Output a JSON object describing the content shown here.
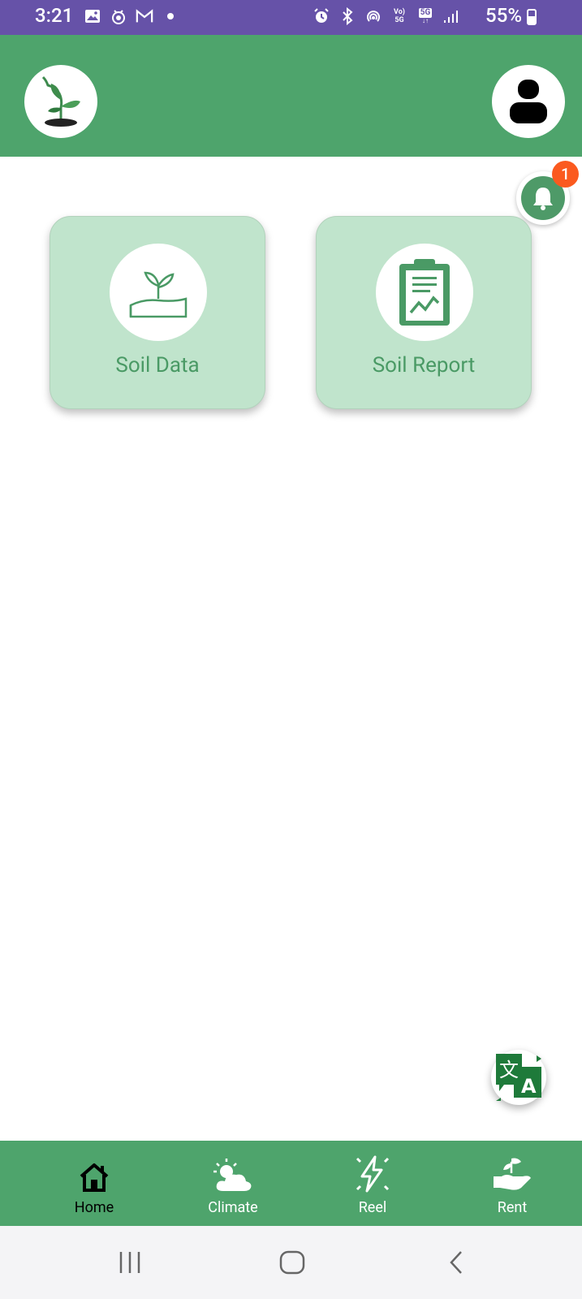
{
  "status_bar": {
    "time": "3:21",
    "battery": "55%",
    "network": "5G",
    "volte_top": "Vo)",
    "volte_bottom": "5G",
    "icons": [
      "gallery-icon",
      "notification-app-icon",
      "gmail-icon",
      "dot-icon",
      "alarm-icon",
      "bluetooth-icon",
      "hotspot-icon",
      "volte-icon",
      "network-5g-icon",
      "signal-icon",
      "battery-icon"
    ]
  },
  "header": {
    "logo_icon": "plant-logo-icon",
    "profile_icon": "user-avatar-icon",
    "background_color": "#4ea46c"
  },
  "notification": {
    "icon": "bell-icon",
    "badge_count": "1"
  },
  "cards": [
    {
      "label": "Soil Data",
      "icon": "soil-sprout-icon"
    },
    {
      "label": "Soil Report",
      "icon": "clipboard-report-icon"
    }
  ],
  "translate": {
    "icon": "translate-icon"
  },
  "bottom_nav": {
    "items": [
      {
        "label": "Home",
        "icon": "home-icon",
        "active": true
      },
      {
        "label": "Climate",
        "icon": "cloud-sun-icon",
        "active": false
      },
      {
        "label": "Reel",
        "icon": "lightning-icon",
        "active": false
      },
      {
        "label": "Rent",
        "icon": "hand-plant-icon",
        "active": false
      }
    ]
  },
  "system_nav": {
    "buttons": [
      "recents-icon",
      "home-circle-icon",
      "back-icon"
    ]
  },
  "colors": {
    "status_bar": "#6652a8",
    "primary_green": "#4ea46c",
    "card_bg": "#c0e4cc",
    "badge": "#fb5a1f"
  }
}
